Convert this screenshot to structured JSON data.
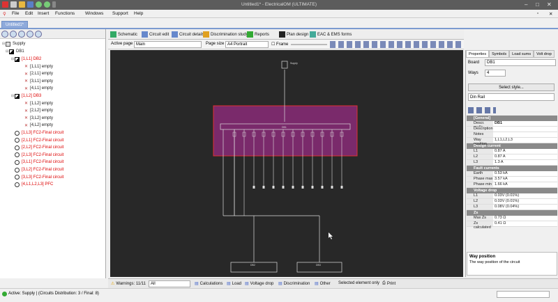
{
  "app": {
    "title": "Untitled1* - ElectricalOM (ULTIMATE)"
  },
  "menu": [
    "File",
    "Edit",
    "Insert",
    "Functions",
    "Windows",
    "Support",
    "Help"
  ],
  "doc_tab": "Untitled1*",
  "tree": {
    "root": "Supply",
    "board": "DB1",
    "items": [
      {
        "label": "[1,L1] DB2",
        "color": "red",
        "indent": 1
      },
      {
        "label": "[1,L1] empty",
        "color": "dark",
        "indent": 2
      },
      {
        "label": "[2,L1] empty",
        "color": "dark",
        "indent": 2
      },
      {
        "label": "[3,L1] empty",
        "color": "dark",
        "indent": 2
      },
      {
        "label": "[4,L1] empty",
        "color": "dark",
        "indent": 2
      },
      {
        "label": "[1,L2] DB3",
        "color": "red",
        "indent": 1
      },
      {
        "label": "[1,L2] empty",
        "color": "dark",
        "indent": 2
      },
      {
        "label": "[2,L2] empty",
        "color": "dark",
        "indent": 2
      },
      {
        "label": "[3,L2] empty",
        "color": "dark",
        "indent": 2
      },
      {
        "label": "[4,L2] empty",
        "color": "dark",
        "indent": 2
      },
      {
        "label": "[1,L3] FC2-Final circuit",
        "color": "red",
        "indent": 1
      },
      {
        "label": "[2,L1] FC2-Final circuit",
        "color": "red",
        "indent": 1
      },
      {
        "label": "[2,L2] FC2-Final circuit",
        "color": "red",
        "indent": 1
      },
      {
        "label": "[2,L3] FC2-Final circuit",
        "color": "red",
        "indent": 1
      },
      {
        "label": "[3,L1] FC2-Final circuit",
        "color": "red",
        "indent": 1
      },
      {
        "label": "[3,L2] FC2-Final circuit",
        "color": "red",
        "indent": 1
      },
      {
        "label": "[3,L3] FC2-Final circuit",
        "color": "red",
        "indent": 1
      },
      {
        "label": "[4,L1,L2,L3] PFC",
        "color": "red",
        "indent": 1
      }
    ]
  },
  "view_tabs": [
    "Schematic",
    "Circuit edit",
    "Circuit details",
    "Discrimination study",
    "Reports",
    "Plan design",
    "EAC & EMS forms"
  ],
  "page_toolbar": {
    "active_page_label": "Active page",
    "active_page": "Main",
    "page_size_label": "Page size",
    "page_size": "A4 Portrait",
    "frame_label": "Frame"
  },
  "schematic": {
    "supply_label": "Supply",
    "board_label": "DB1",
    "sub_boards": [
      "DB2",
      "DB3"
    ],
    "way_labels": [
      "L1",
      "L2",
      "L3"
    ]
  },
  "right_tabs": [
    "Properties",
    "Symbols",
    "Load sums",
    "Volt drop"
  ],
  "props": {
    "board_label": "Board",
    "board": "DB1",
    "ways_label": "Ways",
    "ways": "4",
    "select_style": "Select style...",
    "style_value": "Din Rail",
    "sections": [
      {
        "title": "[General]",
        "rows": [
          [
            "Descr. prefix",
            "DB1"
          ],
          [
            "Description",
            ""
          ],
          [
            "Notes",
            ""
          ],
          [
            "Way position",
            "1,L1,L2,L3"
          ]
        ]
      },
      {
        "title": "Design current",
        "rows": [
          [
            "L1",
            "0.87 A"
          ],
          [
            "L2",
            "0.87 A"
          ],
          [
            "L3",
            "1.3 A"
          ]
        ]
      },
      {
        "title": "Fault currents",
        "rows": [
          [
            "Earth",
            "0.53 kA"
          ],
          [
            "Phase max",
            "3.57 kA"
          ],
          [
            "Phase min",
            "1.66 kA"
          ]
        ]
      },
      {
        "title": "Voltage drop",
        "rows": [
          [
            "L1",
            "0.03V (0.01%)"
          ],
          [
            "L2",
            "0.03V (0.01%)"
          ],
          [
            "L3",
            "0.08V (0.04%)"
          ]
        ]
      },
      {
        "title": "Zs",
        "rows": [
          [
            "Max Zs",
            "0.73 Ω"
          ],
          [
            "Zs calculated",
            "0.41 Ω"
          ]
        ]
      }
    ],
    "help_title": "Way position",
    "help_text": "The way position of the circuit"
  },
  "bottom": {
    "warnings": "Warnings: 11/11",
    "filter": "All",
    "items": [
      "Calculations",
      "Load",
      "Voltage drop",
      "Discrimination",
      "Other"
    ],
    "selected_only": "Selected element only",
    "print": "Print"
  },
  "status": "Active: Supply | (Circuits Distribution: 3 / Final: 8)",
  "colors": {
    "title_bg": "#5c5c5c",
    "tab_accent": "#7b9ad0",
    "canvas": "#282828",
    "highlight": "#7a2a6b",
    "highlight_border": "#e03030",
    "red_text": "#dd0000"
  }
}
